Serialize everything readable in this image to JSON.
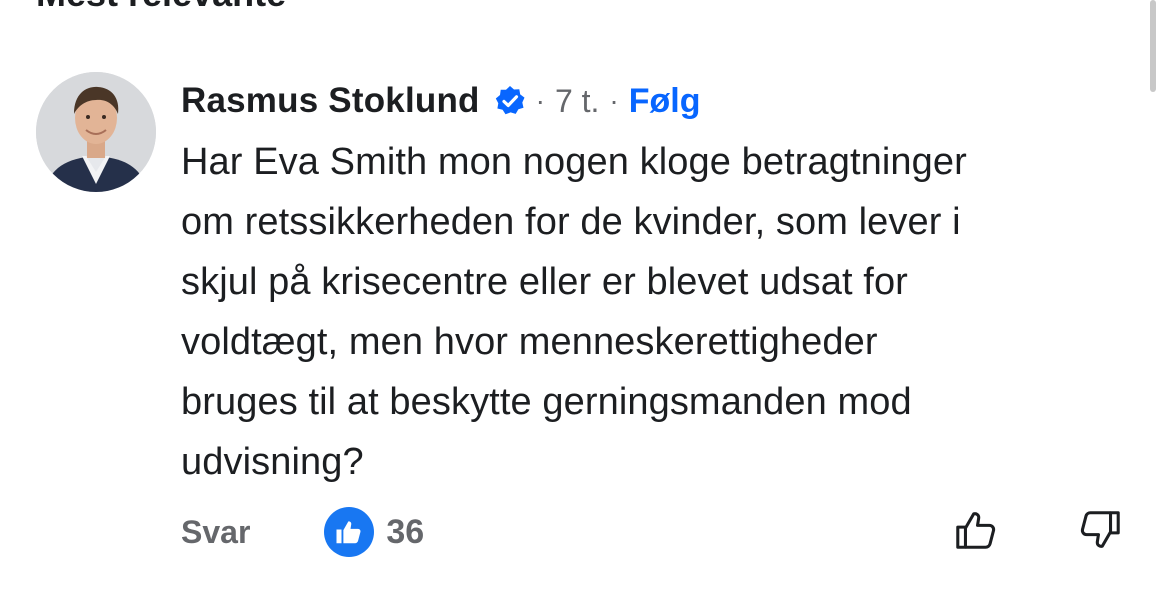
{
  "sort": {
    "label": "Mest relevante",
    "icon": "chevron-down-icon"
  },
  "comment": {
    "author": "Rasmus Stoklund",
    "verified_icon": "verified-badge-icon",
    "time": "7 t.",
    "separator": "·",
    "follow_label": "Følg",
    "text_lines": [
      "Har Eva Smith mon nogen kloge betragtninger",
      "om retssikkerheden for de kvinder, som lever i",
      "skjul på krisecentre eller er blevet udsat for",
      "voldtægt, men hvor menneskerettigheder",
      "bruges til at beskytte gerningsmanden mod",
      "udvisning?"
    ],
    "reply_label": "Svar",
    "like_count": "36",
    "like_icon": "like-reaction-icon",
    "upvote_icon": "thumbs-up-icon",
    "downvote_icon": "thumbs-down-icon"
  },
  "colors": {
    "accent": "#0866ff",
    "like_badge": "#1877f2",
    "muted_text": "#65676b",
    "primary_text": "#1c1e21"
  }
}
